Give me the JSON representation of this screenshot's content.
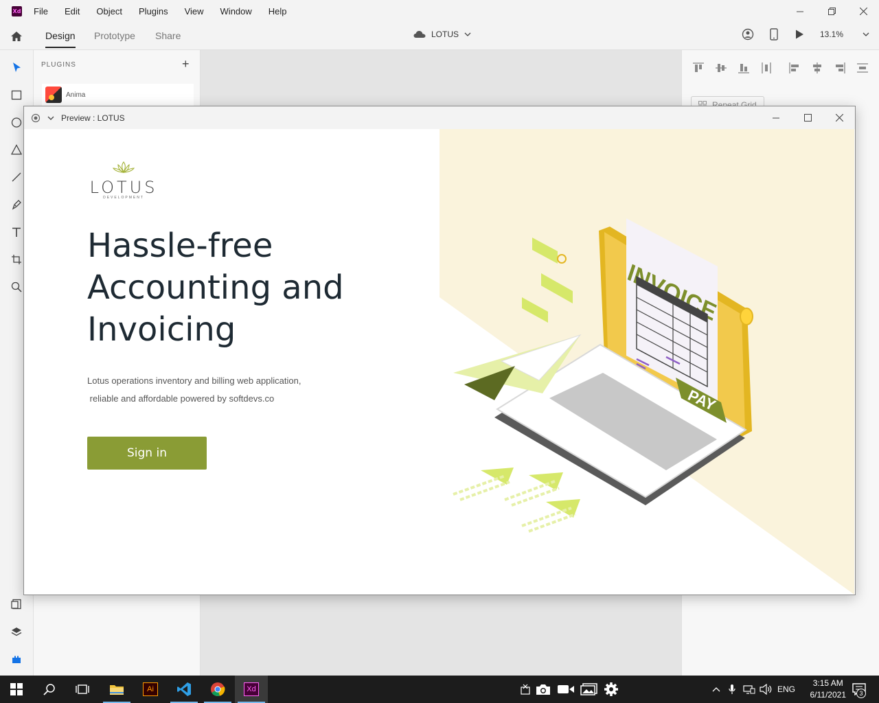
{
  "app": {
    "logo_text": "Xd",
    "menu": [
      "File",
      "Edit",
      "Object",
      "Plugins",
      "View",
      "Window",
      "Help"
    ]
  },
  "modebar": {
    "tabs": [
      "Design",
      "Prototype",
      "Share"
    ],
    "doc_title": "LOTUS",
    "zoom": "13.1%"
  },
  "plugins": {
    "title": "PLUGINS",
    "add": "+",
    "items": [
      {
        "name": "Anima"
      }
    ]
  },
  "inspector": {
    "repeat_grid": "Repeat Grid"
  },
  "preview": {
    "title": "Preview : LOTUS",
    "logo_word": "LOTUS",
    "logo_sub": "DEVELOPMENT",
    "headline_1": "Hassle-free",
    "headline_2": "Accounting and",
    "headline_3": "Invoicing",
    "sub_1": "Lotus operations inventory and billing  web application,",
    "sub_2": " reliable and affordable powered by softdevs.co",
    "signin": "Sign in",
    "illustration": {
      "invoice": "INVOICE",
      "pay": "PAY"
    }
  },
  "taskbar": {
    "ai_label": "Ai",
    "xd_label": "Xd",
    "lang": "ENG",
    "time": "3:15 AM",
    "date": "6/11/2021",
    "notifications": "3"
  },
  "colors": {
    "accent_green": "#8a9c35",
    "xd_purple": "#470137",
    "xd_pink": "#ff61f6",
    "cream": "#faf3dc"
  }
}
